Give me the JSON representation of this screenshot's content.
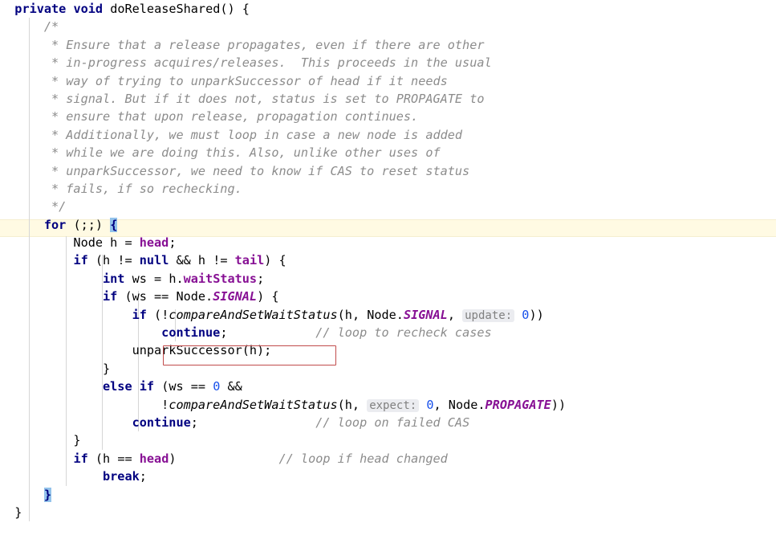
{
  "editor": {
    "language": "java",
    "font_size_px": 15,
    "colors": {
      "background": "#ffffff",
      "keyword": "#000080",
      "field": "#871094",
      "static_field": "#871094",
      "number": "#1750eb",
      "comment": "#8c8c8c",
      "plain_text": "#000000",
      "current_line": "#fffae3",
      "brace_match": "#93c3eb",
      "inlay_hint_bg": "#ebecf0",
      "inlay_hint_fg": "#808080",
      "highlight_box_border": "#c14b4b",
      "indent_guide": "#d6d6d6"
    },
    "current_line_number": 12,
    "highlight_box_label": "unparkSuccessor(h);",
    "brace_match_open": "{",
    "brace_match_close": "}"
  },
  "inlay_hints": [
    {
      "name": "update-hint",
      "label": "update:"
    },
    {
      "name": "expect-hint",
      "label": "expect:"
    }
  ],
  "code": {
    "lines": [
      {
        "n": 1,
        "indent": 0,
        "text": "private void doReleaseShared() {"
      },
      {
        "n": 2,
        "indent": 1,
        "text": "/*"
      },
      {
        "n": 3,
        "indent": 1,
        "text": " * Ensure that a release propagates, even if there are other"
      },
      {
        "n": 4,
        "indent": 1,
        "text": " * in-progress acquires/releases.  This proceeds in the usual"
      },
      {
        "n": 5,
        "indent": 1,
        "text": " * way of trying to unparkSuccessor of head if it needs"
      },
      {
        "n": 6,
        "indent": 1,
        "text": " * signal. But if it does not, status is set to PROPAGATE to"
      },
      {
        "n": 7,
        "indent": 1,
        "text": " * ensure that upon release, propagation continues."
      },
      {
        "n": 8,
        "indent": 1,
        "text": " * Additionally, we must loop in case a new node is added"
      },
      {
        "n": 9,
        "indent": 1,
        "text": " * while we are doing this. Also, unlike other uses of"
      },
      {
        "n": 10,
        "indent": 1,
        "text": " * unparkSuccessor, we need to know if CAS to reset status"
      },
      {
        "n": 11,
        "indent": 1,
        "text": " * fails, if so rechecking."
      },
      {
        "n": 12,
        "indent": 1,
        "text": " */"
      },
      {
        "n": 13,
        "indent": 1,
        "text": "for (;;) {"
      },
      {
        "n": 14,
        "indent": 2,
        "text": "Node h = head;"
      },
      {
        "n": 15,
        "indent": 2,
        "text": "if (h != null && h != tail) {"
      },
      {
        "n": 16,
        "indent": 3,
        "text": "int ws = h.waitStatus;"
      },
      {
        "n": 17,
        "indent": 3,
        "text": "if (ws == Node.SIGNAL) {"
      },
      {
        "n": 18,
        "indent": 4,
        "text": "if (!compareAndSetWaitStatus(h, Node.SIGNAL, update: 0))"
      },
      {
        "n": 19,
        "indent": 5,
        "text": "continue;                // loop to recheck cases"
      },
      {
        "n": 20,
        "indent": 4,
        "text": "unparkSuccessor(h);"
      },
      {
        "n": 21,
        "indent": 3,
        "text": "}"
      },
      {
        "n": 22,
        "indent": 3,
        "text": "else if (ws == 0 &&"
      },
      {
        "n": 23,
        "indent": 6,
        "text": "!compareAndSetWaitStatus(h, expect: 0, Node.PROPAGATE))"
      },
      {
        "n": 24,
        "indent": 4,
        "text": "continue;                // loop on failed CAS"
      },
      {
        "n": 25,
        "indent": 2,
        "text": "}"
      },
      {
        "n": 26,
        "indent": 2,
        "text": "if (h == head)                   // loop if head changed"
      },
      {
        "n": 27,
        "indent": 3,
        "text": "break;"
      },
      {
        "n": 28,
        "indent": 1,
        "text": "}"
      },
      {
        "n": 29,
        "indent": 0,
        "text": "}"
      }
    ],
    "comments": {
      "block_open": "/*",
      "block_close": "*/",
      "trailing_1": "// loop to recheck cases",
      "trailing_2": "// loop on failed CAS",
      "trailing_3": "// loop if head changed"
    },
    "identifiers": {
      "method_name": "doReleaseShared",
      "fields": [
        "head",
        "tail",
        "waitStatus"
      ],
      "constants": [
        "SIGNAL",
        "PROPAGATE"
      ],
      "method_calls": [
        "compareAndSetWaitStatus",
        "unparkSuccessor"
      ],
      "types": [
        "Node",
        "int",
        "void"
      ],
      "locals": [
        "h",
        "ws"
      ],
      "literals": [
        "0",
        "null"
      ]
    }
  }
}
